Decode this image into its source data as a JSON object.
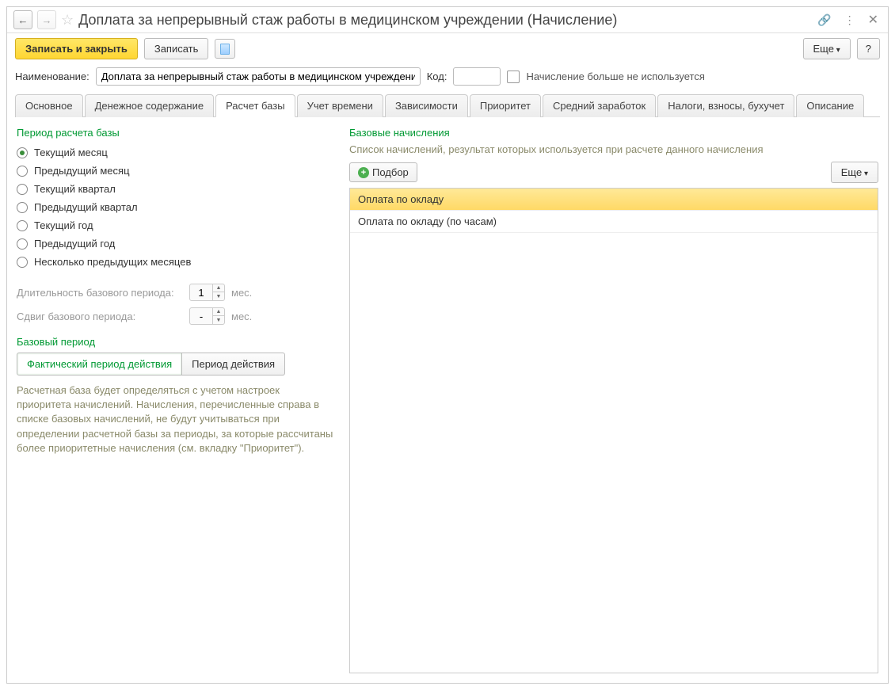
{
  "title": "Доплата за непрерывный стаж работы в медицинском учреждении (Начисление)",
  "toolbar": {
    "save_close": "Записать и закрыть",
    "save": "Записать",
    "more": "Еще",
    "help": "?"
  },
  "fields": {
    "name_label": "Наименование:",
    "name_value": "Доплата за непрерывный стаж работы в медицинском учреждении",
    "code_label": "Код:",
    "code_value": "",
    "not_used_label": "Начисление больше не используется"
  },
  "tabs": [
    "Основное",
    "Денежное содержание",
    "Расчет базы",
    "Учет времени",
    "Зависимости",
    "Приоритет",
    "Средний заработок",
    "Налоги, взносы, бухучет",
    "Описание"
  ],
  "active_tab_index": 2,
  "left": {
    "period_section": "Период расчета базы",
    "radios": [
      "Текущий месяц",
      "Предыдущий месяц",
      "Текущий квартал",
      "Предыдущий квартал",
      "Текущий год",
      "Предыдущий год",
      "Несколько предыдущих месяцев"
    ],
    "selected_radio": 0,
    "duration_label": "Длительность базового периода:",
    "duration_value": "1",
    "shift_label": "Сдвиг базового периода:",
    "shift_value": "-",
    "unit": "мес.",
    "base_period_section": "Базовый период",
    "toggle_actual": "Фактический период действия",
    "toggle_action": "Период действия",
    "description": "Расчетная база будет определяться с учетом настроек приоритета начислений. Начисления, перечисленные справа в списке базовых начислений, не будут учитываться при определении расчетной базы за периоды, за которые рассчитаны более приоритетные начисления (см. вкладку \"Приоритет\")."
  },
  "right": {
    "section": "Базовые начисления",
    "description": "Список начислений, результат которых используется при расчете данного начисления",
    "add_label": "Подбор",
    "more": "Еще",
    "rows": [
      "Оплата по окладу",
      "Оплата по окладу (по часам)"
    ],
    "selected_row": 0
  }
}
